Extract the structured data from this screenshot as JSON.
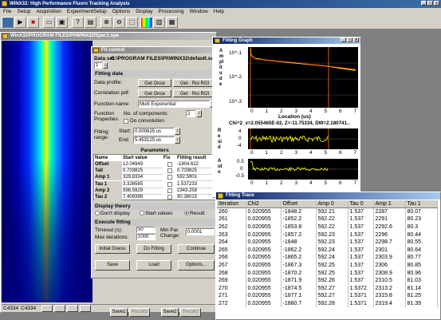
{
  "app": {
    "title": "WINX32: High Performance Fluoro Tracking Analysis",
    "menu": [
      "File",
      "Setup",
      "Acquisition",
      "ExperimentSetup",
      "Options",
      "Display",
      "Processing",
      "Window",
      "Help"
    ]
  },
  "image_window": {
    "title": "WinX32/PROGRAM FILES/PI/WINX32/Spec1.spe",
    "status_left": "C4334",
    "status_mid": "C4334"
  },
  "fit_control": {
    "title": "Fit control",
    "data_set_label": "Data set:",
    "data_set_number": "1",
    "data_path": "C:\\PROGRAM FILES\\PI\\WINX32\\default.set",
    "fitting_data_header": "Fitting data",
    "data_profile_label": "Data profile:",
    "corr_pdf_label": "Correlation pdf:",
    "get_once": "Get Once",
    "get_roi": "Get · Roi ROI",
    "function_name_label": "Function name:",
    "function_name_value": "Multi Exponential",
    "function_properties_label": "Function Properties:",
    "num_components_label": "No. of components:",
    "num_components_value": "2",
    "deconvolution_label": "Do convolution",
    "fitting_range_label": "Fitting range:",
    "start_label": "Start:",
    "start_value": "0.000625 us",
    "end_label": "End:",
    "end_value": "5.453125 us",
    "params_header": "Parameters",
    "param_cols": [
      "Name",
      "Start value",
      "Fix",
      "Fitting result"
    ],
    "params": [
      {
        "name": "Offset",
        "start": "12.04949",
        "result": "-1804.622"
      },
      {
        "name": "Tall",
        "start": "0.703825",
        "result": "0.703825"
      },
      {
        "name": "Amp 1",
        "start": "329.8334",
        "result": "592.5901"
      },
      {
        "name": "Tau 1",
        "start": "3.326585",
        "result": "1.537233"
      },
      {
        "name": "Amp 2",
        "start": "598.5929",
        "result": "2343.258"
      },
      {
        "name": "Tau 2",
        "start": "7.409398",
        "result": "90.38015"
      }
    ],
    "display_theory_header": "Display theory",
    "display_opts": [
      "Don't display",
      "Start values",
      "Result"
    ],
    "execute_header": "Execute fitting",
    "timeout_label": "Timeout (s):",
    "timeout_value": "50",
    "max_iter_label": "Max iterations:",
    "max_iter_value": "1000",
    "min_par_label": "Min Par Change:",
    "min_par_value": "0.0001",
    "initial_guess": "Initial Guess",
    "do_fitting": "Do Fitting",
    "continue": "Continue",
    "save": "Save",
    "load": "Load",
    "options": "Options..."
  },
  "fitting_graph": {
    "title": "Fitting Graph",
    "y_label_main": "Amplitude",
    "y_ticks_main": [
      "10^-3",
      "10^-2",
      "10^-1"
    ],
    "x_ticks": [
      "0",
      "1",
      "2",
      "3",
      "4",
      "5",
      "6",
      "7"
    ],
    "x_label": "Location (us)",
    "chi_text": "Chi^2_v=2.055465E-02, Z=-11.75334, DW=2.180741..",
    "resid_label": "Resid",
    "resid_ticks": [
      "4",
      "0",
      "-4"
    ],
    "auto_label": "Auto",
    "auto_ticks": [
      "0.5",
      "0",
      "-0.5"
    ]
  },
  "fitting_trace": {
    "title": "Fitting Trace",
    "columns": [
      "Iteration",
      "Chi2",
      "Offset",
      "Amp 0",
      "Tau 0",
      "Amp 1",
      "Tau 1"
    ],
    "rows": [
      [
        "260",
        "0.020955",
        "-1848.2",
        "592.21",
        "1.537",
        "2287",
        "80.07"
      ],
      [
        "261",
        "0.020955",
        "-1852.2",
        "592.22",
        "1.537",
        "2291",
        "80.23"
      ],
      [
        "262",
        "0.020955",
        "-1853.8",
        "592.22",
        "1.537",
        "2292.6",
        "80.3"
      ],
      [
        "263",
        "0.020955",
        "-1857.2",
        "592.23",
        "1.537",
        "2296",
        "80.44"
      ],
      [
        "264",
        "0.020955",
        "-1848",
        "592.23",
        "1.537",
        "2298.7",
        "80.55"
      ],
      [
        "265",
        "0.020955",
        "-1862.2",
        "592.24",
        "1.537",
        "2301",
        "80.64"
      ],
      [
        "266",
        "0.020955",
        "-1865.2",
        "592.24",
        "1.537",
        "2303.9",
        "80.77"
      ],
      [
        "267",
        "0.020955",
        "-1867.3",
        "592.25",
        "1.537",
        "2306",
        "80.85"
      ],
      [
        "268",
        "0.020955",
        "-1870.2",
        "592.25",
        "1.537",
        "2308.9",
        "80.96"
      ],
      [
        "269",
        "0.020955",
        "-1871.9",
        "592.26",
        "1.537",
        "2310.5",
        "81.03"
      ],
      [
        "270",
        "0.020955",
        "-1874.5",
        "592.27",
        "1.5372",
        "2313.2",
        "81.14"
      ],
      [
        "271",
        "0.020955",
        "-1877.1",
        "592.27",
        "1.5371",
        "2315.8",
        "81.25"
      ],
      [
        "272",
        "0.020955",
        "-1880.7",
        "592.28",
        "1.5371",
        "2319.4",
        "81.39"
      ]
    ]
  },
  "taskbar": {
    "save1": "Save1",
    "recall1": "Recall1",
    "save2": "Save2",
    "recall2": "Recall2"
  }
}
